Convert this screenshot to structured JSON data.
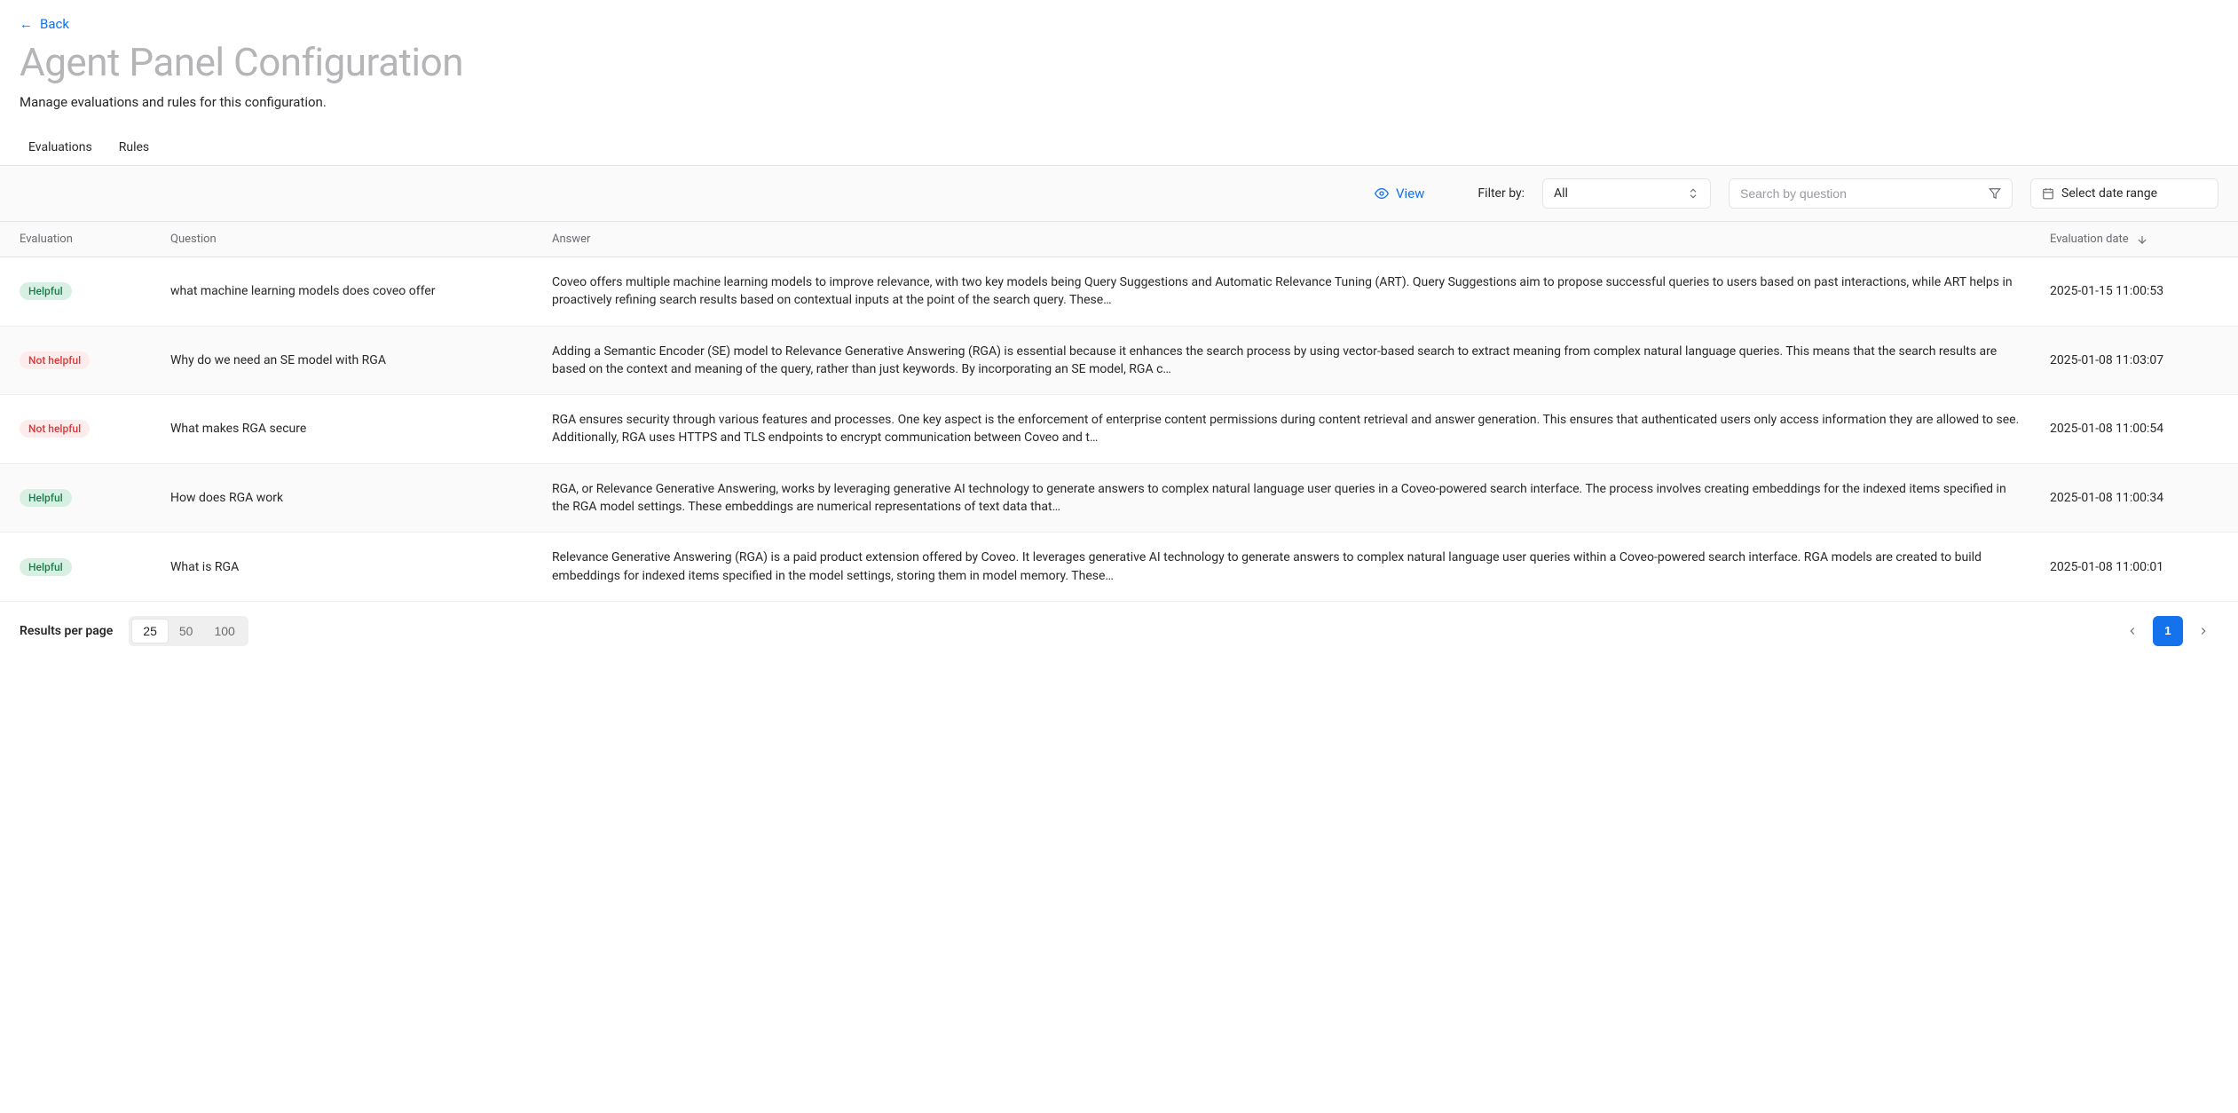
{
  "back": {
    "label": "Back"
  },
  "title": "Agent Panel Configuration",
  "subtitle": "Manage evaluations and rules for this configuration.",
  "tabs": {
    "evaluations": "Evaluations",
    "rules": "Rules"
  },
  "toolbar": {
    "view": "View",
    "filter_label": "Filter by:",
    "filter_value": "All",
    "search_placeholder": "Search by question",
    "date_placeholder": "Select date range"
  },
  "columns": {
    "evaluation": "Evaluation",
    "question": "Question",
    "answer": "Answer",
    "date": "Evaluation date"
  },
  "badge_labels": {
    "helpful": "Helpful",
    "not_helpful": "Not helpful"
  },
  "rows": [
    {
      "eval": "helpful",
      "question": "what machine learning models does coveo offer",
      "answer": "Coveo offers multiple machine learning models to improve relevance, with two key models being Query Suggestions and Automatic Relevance Tuning (ART). Query Suggestions aim to propose successful queries to users based on past interactions, while ART helps in proactively refining search results based on contextual inputs at the point of the search query. These…",
      "date": "2025-01-15 11:00:53"
    },
    {
      "eval": "not_helpful",
      "question": "Why do we need an SE model with RGA",
      "answer": "Adding a Semantic Encoder (SE) model to Relevance Generative Answering (RGA) is essential because it enhances the search process by using vector-based search to extract meaning from complex natural language queries. This means that the search results are based on the context and meaning of the query, rather than just keywords. By incorporating an SE model, RGA c…",
      "date": "2025-01-08 11:03:07"
    },
    {
      "eval": "not_helpful",
      "question": "What makes RGA secure",
      "answer": "RGA ensures security through various features and processes. One key aspect is the enforcement of enterprise content permissions during content retrieval and answer generation. This ensures that authenticated users only access information they are allowed to see. Additionally, RGA uses HTTPS and TLS endpoints to encrypt communication between Coveo and t…",
      "date": "2025-01-08 11:00:54"
    },
    {
      "eval": "helpful",
      "question": "How does RGA work",
      "answer": "RGA, or Relevance Generative Answering, works by leveraging generative AI technology to generate answers to complex natural language user queries in a Coveo-powered search interface. The process involves creating embeddings for the indexed items specified in the RGA model settings. These embeddings are numerical representations of text data that…",
      "date": "2025-01-08 11:00:34"
    },
    {
      "eval": "helpful",
      "question": "What is RGA",
      "answer": "Relevance Generative Answering (RGA) is a paid product extension offered by Coveo. It leverages generative AI technology to generate answers to complex natural language user queries within a Coveo-powered search interface. RGA models are created to build embeddings for indexed items specified in the model settings, storing them in model memory. These…",
      "date": "2025-01-08 11:00:01"
    }
  ],
  "footer": {
    "rpp_label": "Results per page",
    "rpp_options": [
      "25",
      "50",
      "100"
    ],
    "rpp_active": "25",
    "current_page": "1"
  }
}
